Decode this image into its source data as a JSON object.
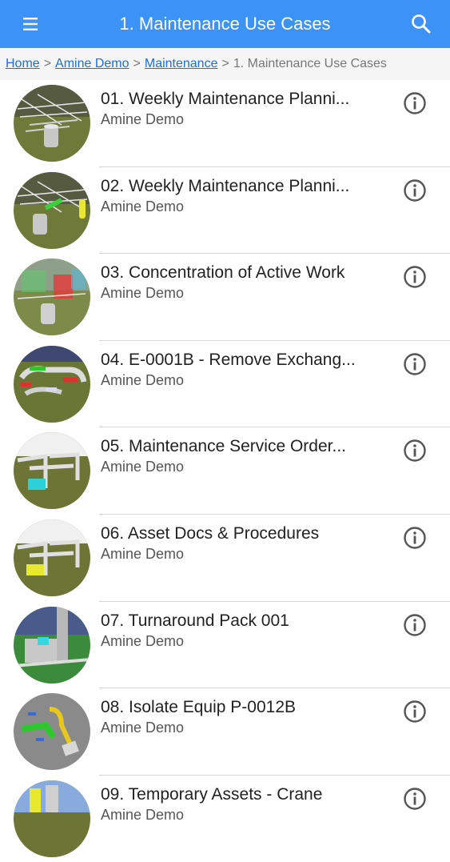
{
  "appbar": {
    "menu_icon": "menu-icon",
    "title": "1. Maintenance Use Cases",
    "search_icon": "search-icon",
    "color": "#3d93f5"
  },
  "breadcrumb": {
    "items": [
      "Home",
      "Amine Demo",
      "Maintenance"
    ],
    "separator": ">",
    "current": "1. Maintenance Use Cases"
  },
  "list": {
    "items": [
      {
        "title": "01. Weekly Maintenance Planni...",
        "subtitle": "Amine Demo"
      },
      {
        "title": "02. Weekly Maintenance Planni...",
        "subtitle": "Amine Demo"
      },
      {
        "title": "03. Concentration of Active Work",
        "subtitle": "Amine Demo"
      },
      {
        "title": "04. E-0001B - Remove Exchang...",
        "subtitle": "Amine Demo"
      },
      {
        "title": "05. Maintenance Service Order...",
        "subtitle": "Amine Demo"
      },
      {
        "title": "06. Asset Docs & Procedures",
        "subtitle": "Amine Demo"
      },
      {
        "title": "07. Turnaround Pack 001",
        "subtitle": "Amine Demo"
      },
      {
        "title": "08. Isolate Equip P-0012B",
        "subtitle": "Amine Demo"
      },
      {
        "title": "09. Temporary Assets - Crane",
        "subtitle": "Amine Demo"
      }
    ]
  }
}
